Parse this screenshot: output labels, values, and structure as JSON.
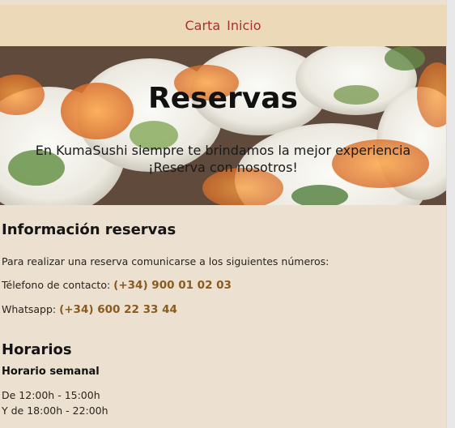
{
  "nav": {
    "items": [
      "Carta",
      "Inicio"
    ]
  },
  "hero": {
    "title": "Reservas",
    "subtitle_line1": "En KumaSushi siempre te brindamos la mejor experiencia",
    "subtitle_line2": "¡Reserva con nosotros!"
  },
  "info": {
    "heading": "Información reservas",
    "intro": "Para realizar una reserva comunicarse a los siguientes números:",
    "phone_label": "Télefono de contacto: ",
    "phone_value": "(+34) 900 01 02 03",
    "whatsapp_label": "Whatsapp: ",
    "whatsapp_value": "(+34) 600 22 33 44"
  },
  "schedule": {
    "heading": "Horarios",
    "subheading": "Horario semanal",
    "line1": "De 12:00h - 15:00h",
    "line2": "Y de 18:00h - 22:00h"
  },
  "colors": {
    "nav_link": "#a3342d",
    "phone": "#8a5a1e",
    "background": "#ece1d0",
    "nav_bg": "#ecd9b8"
  }
}
